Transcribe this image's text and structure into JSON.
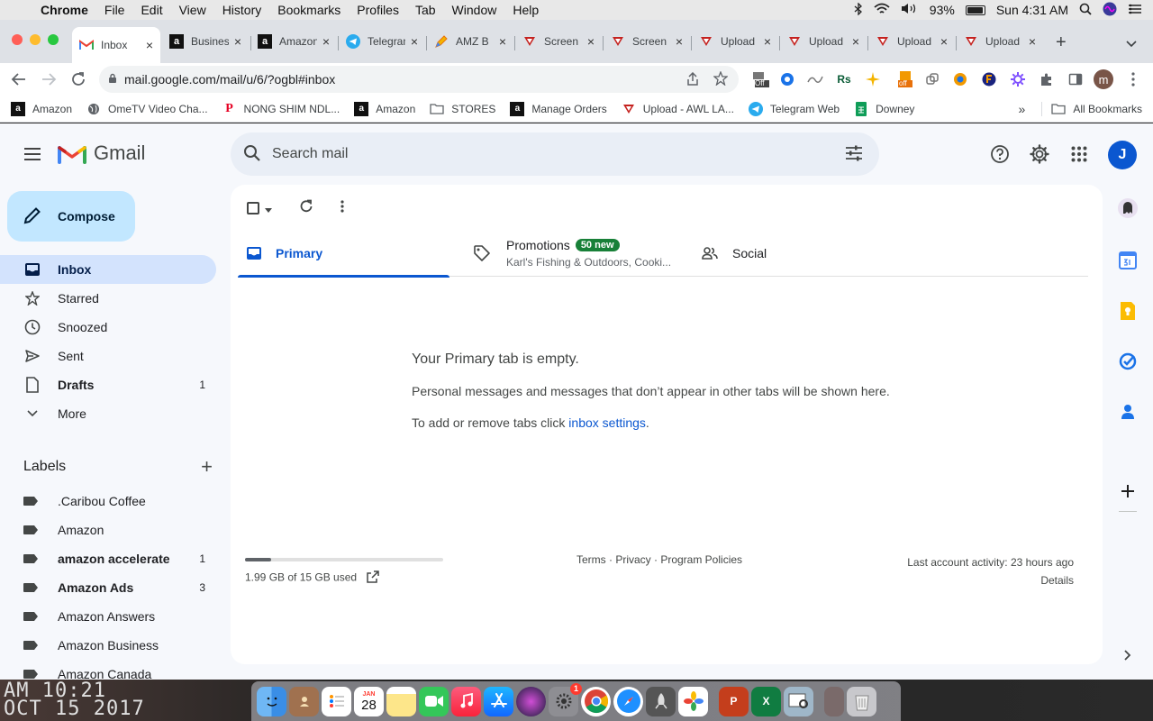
{
  "menubar": {
    "app": "Chrome",
    "items": [
      "File",
      "Edit",
      "View",
      "History",
      "Bookmarks",
      "Profiles",
      "Tab",
      "Window",
      "Help"
    ],
    "battery": "93%",
    "battery_level": 0.93,
    "datetime": "Sun 4:31 AM"
  },
  "tabs": [
    {
      "title": "Inbox",
      "favicon": "gmail-icon",
      "active": true
    },
    {
      "title": "Business",
      "favicon": "amazon-icon"
    },
    {
      "title": "Amazon",
      "favicon": "amazon-icon"
    },
    {
      "title": "Telegram",
      "favicon": "telegram-icon"
    },
    {
      "title": "AMZ B",
      "favicon": "pencil-icon"
    },
    {
      "title": "Screen",
      "favicon": "triangle-icon"
    },
    {
      "title": "Screen",
      "favicon": "triangle-icon"
    },
    {
      "title": "Upload",
      "favicon": "triangle-icon"
    },
    {
      "title": "Upload",
      "favicon": "triangle-icon"
    },
    {
      "title": "Upload",
      "favicon": "triangle-icon"
    },
    {
      "title": "Upload",
      "favicon": "triangle-icon"
    }
  ],
  "address": {
    "url": "mail.google.com/mail/u/6/?ogbl#inbox"
  },
  "profile_initial": "m",
  "extension_badge": "Off",
  "extension_badge2": "off",
  "bookmarks": {
    "items": [
      {
        "label": "Amazon",
        "icon": "amazon-icon"
      },
      {
        "label": "OmeTV Video Cha...",
        "icon": "globe-icon"
      },
      {
        "label": "NONG SHIM NDL...",
        "icon": "pinterest-icon"
      },
      {
        "label": "Amazon",
        "icon": "amazon-icon"
      },
      {
        "label": "STORES",
        "icon": "folder-icon"
      },
      {
        "label": "Manage Orders",
        "icon": "amazon-icon"
      },
      {
        "label": "Upload - AWL LA...",
        "icon": "triangle-icon"
      },
      {
        "label": "Telegram Web",
        "icon": "telegram-icon"
      },
      {
        "label": "Downey",
        "icon": "sheets-icon"
      }
    ],
    "more": "»",
    "all": "All Bookmarks"
  },
  "gmail": {
    "logo": "Gmail",
    "search_placeholder": "Search mail",
    "avatar": "J",
    "compose": "Compose",
    "nav": [
      {
        "label": "Inbox",
        "icon": "inbox-icon",
        "active": true,
        "count": ""
      },
      {
        "label": "Starred",
        "icon": "star-icon",
        "count": ""
      },
      {
        "label": "Snoozed",
        "icon": "clock-icon",
        "count": ""
      },
      {
        "label": "Sent",
        "icon": "send-icon",
        "count": ""
      },
      {
        "label": "Drafts",
        "icon": "draft-icon",
        "count": "1",
        "bold": true
      },
      {
        "label": "More",
        "icon": "chevron-down-icon",
        "count": ""
      }
    ],
    "labels_title": "Labels",
    "labels": [
      {
        "label": ".Caribou Coffee",
        "count": ""
      },
      {
        "label": "Amazon",
        "count": ""
      },
      {
        "label": "amazon accelerate",
        "count": "1",
        "bold": true
      },
      {
        "label": "Amazon Ads",
        "count": "3",
        "bold": true
      },
      {
        "label": "Amazon Answers",
        "count": ""
      },
      {
        "label": "Amazon Business",
        "count": ""
      },
      {
        "label": "Amazon Canada",
        "count": ""
      }
    ],
    "tabs": {
      "primary": "Primary",
      "promotions": "Promotions",
      "promotions_badge": "50 new",
      "promotions_sub": "Karl's Fishing & Outdoors, Cooki...",
      "social": "Social"
    },
    "empty": {
      "heading": "Your Primary tab is empty.",
      "body": "Personal messages and messages that don’t appear in other tabs will be shown here.",
      "settings_prefix": "To add or remove tabs click ",
      "settings_link": "inbox settings",
      "settings_suffix": "."
    },
    "footer": {
      "storage": "1.99 GB of 15 GB used",
      "storage_fraction": 0.133,
      "links": "Terms · Privacy · Program Policies",
      "activity": "Last account activity: 23 hours ago",
      "details": "Details"
    }
  },
  "desktop": {
    "clock_line1": "AM 10:21",
    "clock_line2": "OCT 15 2017"
  },
  "dock": {
    "calendar_month": "JAN",
    "calendar_day": "28",
    "badge": "1"
  },
  "colors": {
    "accent": "#0b57d0",
    "compose": "#c2e7ff",
    "active_nav": "#d3e3fd",
    "badge_green": "#188038"
  }
}
